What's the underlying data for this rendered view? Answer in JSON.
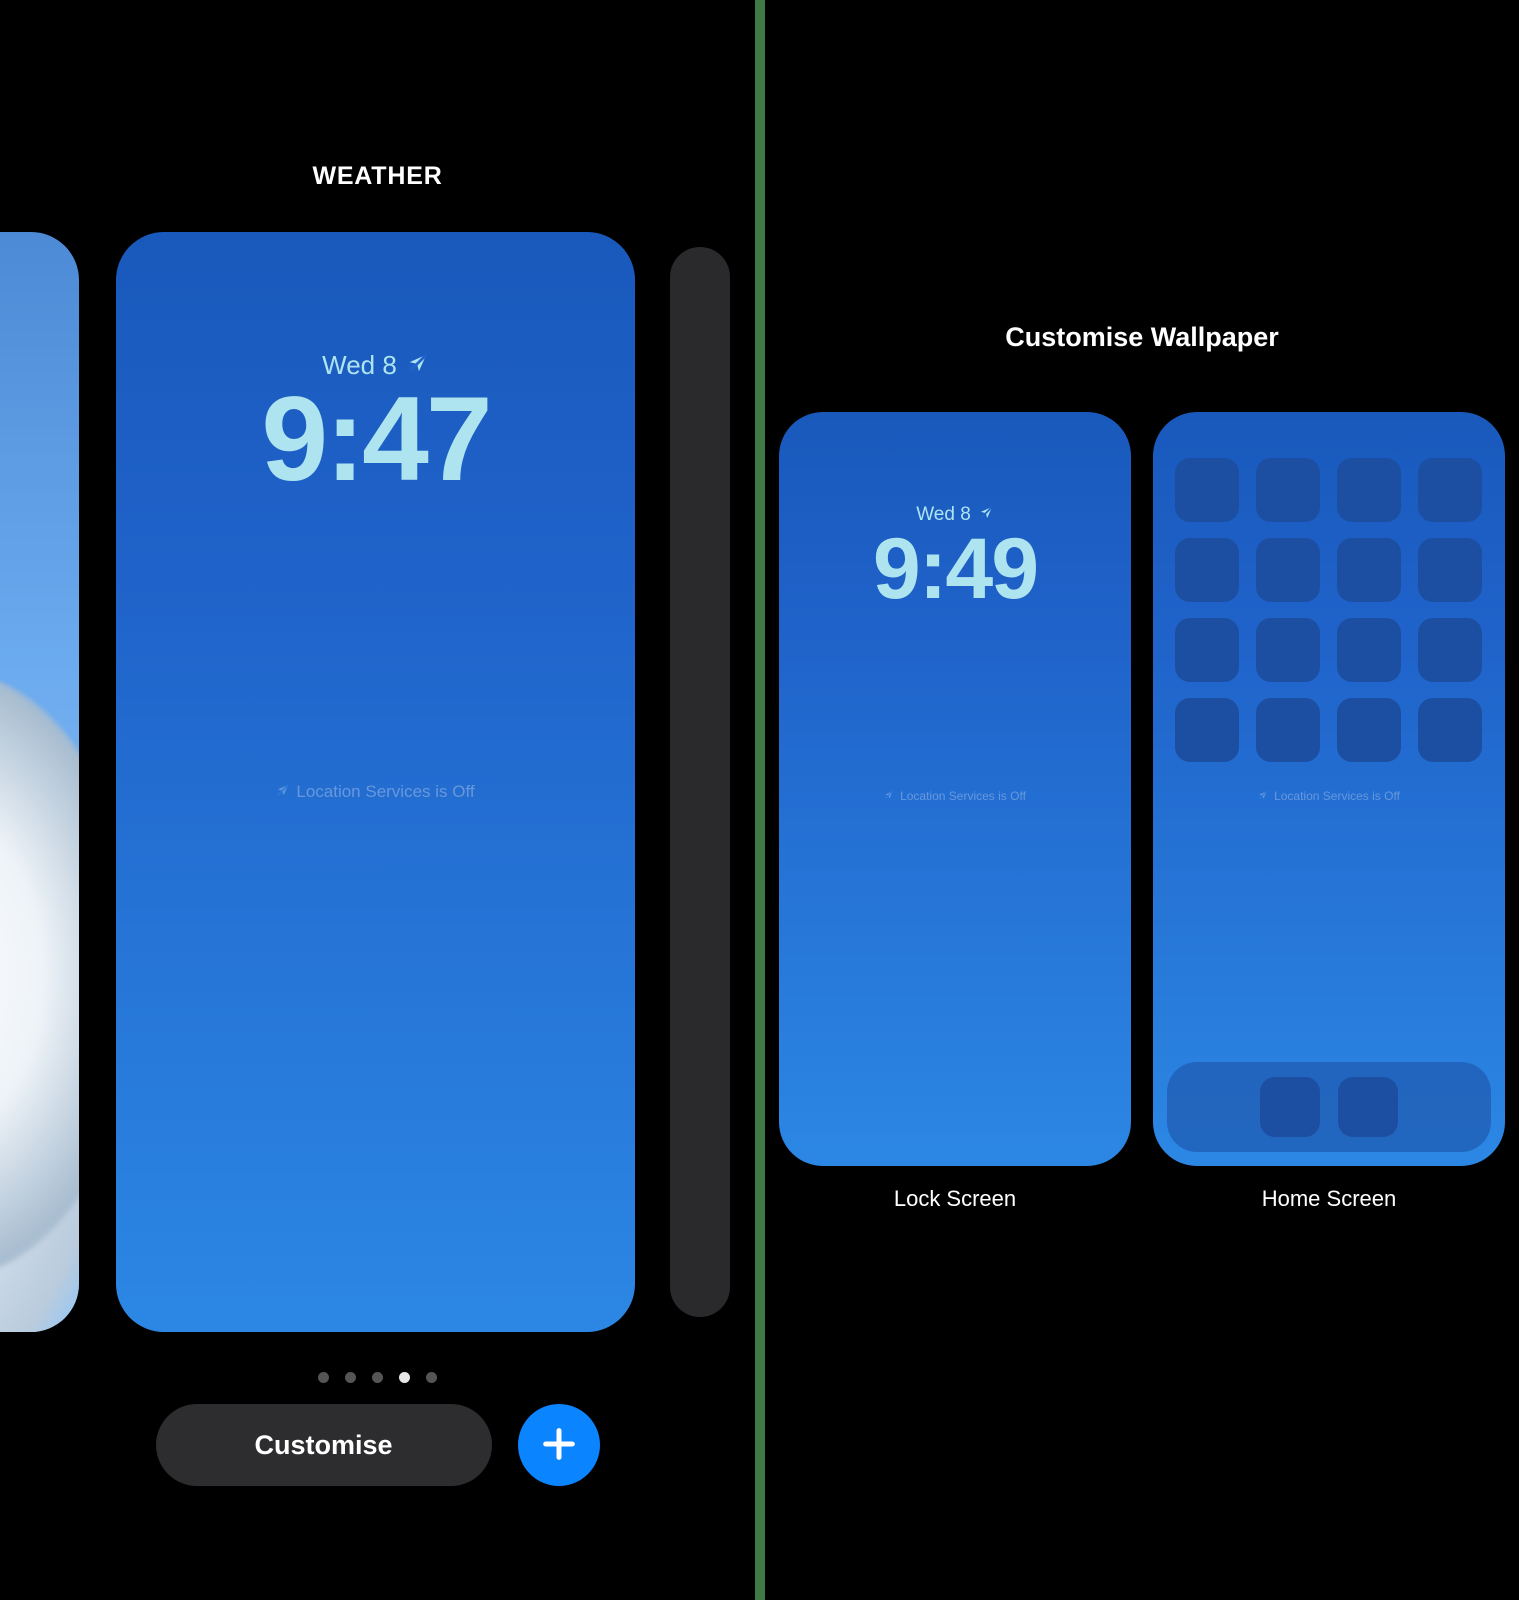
{
  "left": {
    "title": "WEATHER",
    "date": "Wed 8",
    "time": "9:47",
    "locationMsg": "Location Services is Off",
    "customiseLabel": "Customise",
    "page": {
      "count": 5,
      "active": 3
    }
  },
  "right": {
    "title": "Customise Wallpaper",
    "lock": {
      "date": "Wed 8",
      "time": "9:49",
      "locationMsg": "Location Services is Off",
      "label": "Lock Screen"
    },
    "home": {
      "locationMsg": "Location Services is Off",
      "label": "Home Screen",
      "gridRows": 4,
      "gridCols": 4,
      "dockCount": 2
    }
  }
}
